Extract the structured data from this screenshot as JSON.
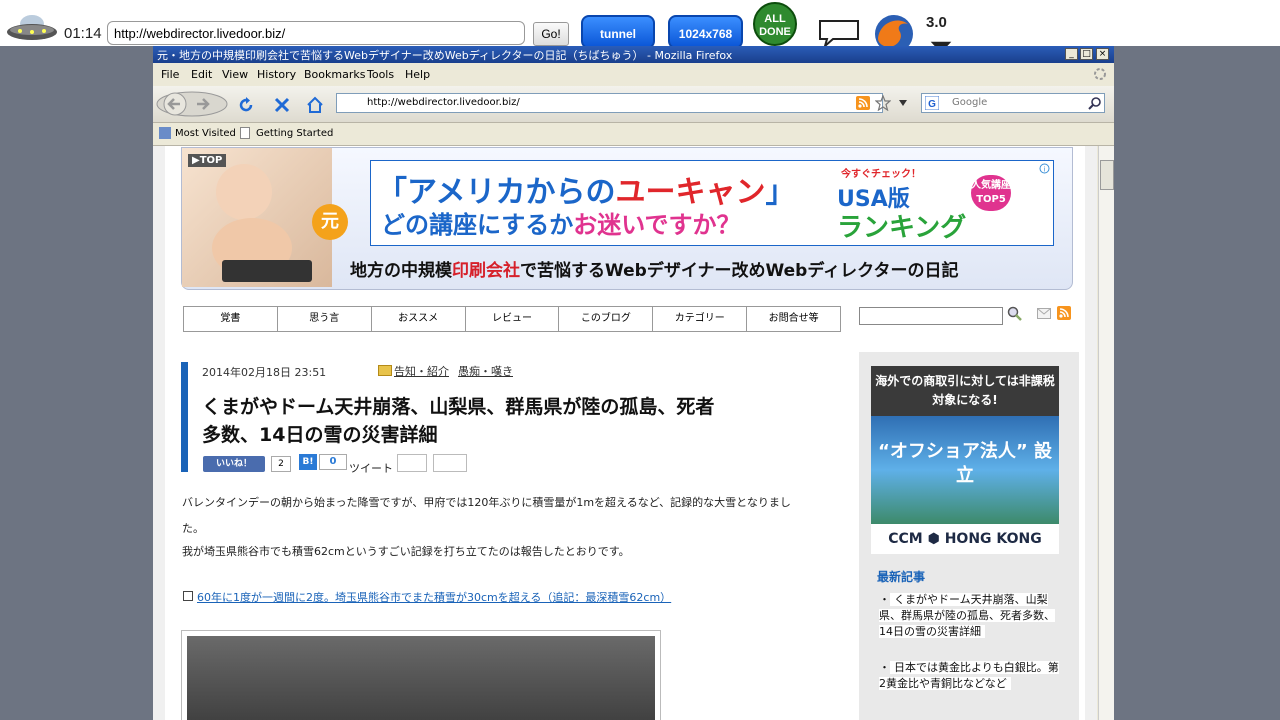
{
  "toolbar": {
    "timer": "01:14",
    "url": "http://webdirector.livedoor.biz/",
    "go_label": "Go!",
    "tunnel_label": "tunnel",
    "resolution_label": "1024x768",
    "all_done_label": "ALL DONE",
    "version": "3.0"
  },
  "window": {
    "title": "元・地方の中規模印刷会社で苦悩するWebデザイナー改めWebディレクターの日記（ちばちゅう） - Mozilla Firefox",
    "menus": [
      "File",
      "Edit",
      "View",
      "History",
      "Bookmarks",
      "Tools",
      "Help"
    ],
    "address": "http://webdirector.livedoor.biz/",
    "search_placeholder": "Google",
    "bookmarks": [
      "Most Visited",
      "Getting Started"
    ]
  },
  "page": {
    "top_link": "▶TOP",
    "ad_line1a": "「アメリカからの",
    "ad_line1b": "ユーキャン",
    "ad_line1c": "」",
    "ad_line2a": "どの講座にするか",
    "ad_line2b": "お迷いですか？",
    "ad_tag": "今すぐチェック！",
    "ad_right1": "USA版",
    "ad_right2": "ランキング",
    "ad_top5": "人気講座 TOP5",
    "moto_badge": "元",
    "blog_title_a": "地方の中規模",
    "blog_title_b": "印刷会社",
    "blog_title_c": "で苦悩するWebデザイナー改めWebディレクターの日記",
    "nav": [
      "覚書",
      "思う言",
      "おススメ",
      "レビュー",
      "このブログ",
      "カテゴリー",
      "お問合せ等"
    ],
    "article": {
      "date": "2014年02月18日 23:51",
      "categories": [
        "告知・紹介",
        "愚痴・嘆き"
      ],
      "title_line1": "くまがやドーム天井崩落、山梨県、群馬県が陸の孤島、死者",
      "title_line2": "多数、14日の雪の災害詳細",
      "like_label": "いいね！",
      "like_count": "2",
      "hatena_label": "B!",
      "hatena_count": "0",
      "tweet_label": "ツイート",
      "para1": "バレンタインデーの朝から始まった降雪ですが、甲府では120年ぶりに積雪量が1mを超えるなど、記録的な大雪となりまし",
      "para1b": "た。",
      "para2": "我が埼玉県熊谷市でも積雪62cmというすごい記録を打ち立てたのは報告したとおりです。",
      "link": "60年に1度が一週間に2度。埼玉県熊谷市でまた積雪が30cmを超える（追記：最深積雪62cm）"
    },
    "sidebar": {
      "ad_head": "海外での商取引に対しては非課税対象になる!",
      "ad_mid": "“オフショア法人” 設立",
      "ad_foot": "CCM ⬢ HONG KONG",
      "recent_title": "最新記事",
      "recent": [
        "くまがやドーム天井崩落、山梨県、群馬県が陸の孤島、死者多数、14日の雪の災害詳細",
        "日本では黄金比よりも白銀比。第2黄金比や青銅比などなど"
      ]
    }
  },
  "colors": {
    "accent": "#1a63b8",
    "red": "#d6202a",
    "titlebar": "#2b5db8"
  }
}
